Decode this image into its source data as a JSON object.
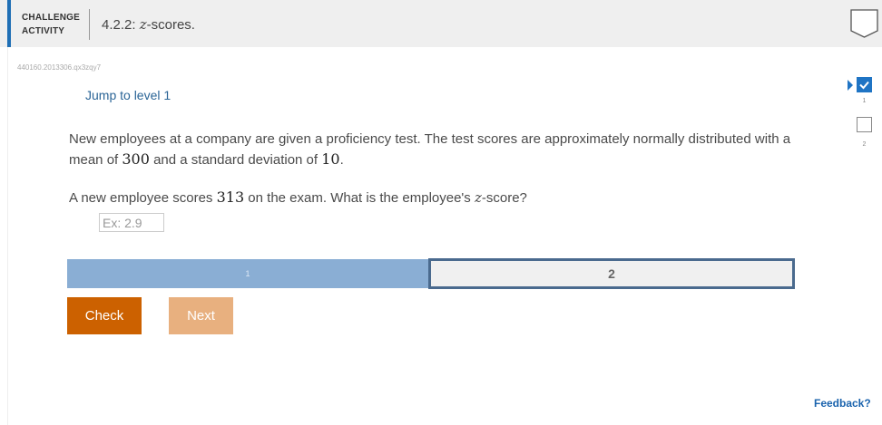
{
  "header": {
    "kind_line1": "CHALLENGE",
    "kind_line2": "ACTIVITY",
    "title_prefix": "4.2.2: ",
    "title_var": "z",
    "title_suffix": "-scores."
  },
  "activity_code": "440160.2013306.qx3zqy7",
  "jump_link": "Jump to level 1",
  "question": {
    "text1": "New employees at a company are given a proficiency test. The test scores are approximately normally distributed with a mean of ",
    "mean": "300",
    "text2": " and a standard deviation of ",
    "sd": "10",
    "text3": ".",
    "q_text1": "A new employee scores ",
    "score": "313",
    "q_text2": " on the exam. What is the employee's ",
    "q_var": "z",
    "q_text3": "-score?"
  },
  "answer": {
    "placeholder": "Ex: 2.9",
    "value": ""
  },
  "levels": [
    {
      "label": "1",
      "completed": true
    },
    {
      "label": "2",
      "completed": false,
      "current": true
    }
  ],
  "buttons": {
    "check": "Check",
    "next": "Next"
  },
  "side_indicators": [
    {
      "label": "1",
      "completed": true
    },
    {
      "label": "2",
      "completed": false
    }
  ],
  "feedback": "Feedback?",
  "colors": {
    "accent": "#1f6fb5",
    "check_button": "#cc6100",
    "next_button": "#e8b07f",
    "level_completed": "#8aaed4",
    "level_current_border": "#4a6a8e"
  }
}
